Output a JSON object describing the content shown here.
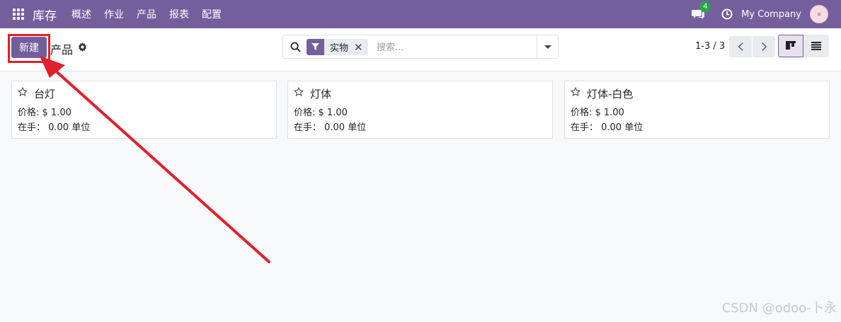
{
  "topbar": {
    "app_name": "库存",
    "menu": [
      "概述",
      "作业",
      "产品",
      "报表",
      "配置"
    ],
    "chat_badge": "4",
    "company": "My Company"
  },
  "control": {
    "new_label": "新建",
    "breadcrumb": "产品",
    "facet_label": "实物",
    "search_placeholder": "搜索...",
    "pager": "1-3 / 3"
  },
  "products": [
    {
      "name": "台灯",
      "price": "价格: $ 1.00",
      "onhand": "在手： 0.00 单位"
    },
    {
      "name": "灯体",
      "price": "价格: $ 1.00",
      "onhand": "在手： 0.00 单位"
    },
    {
      "name": "灯体-白色",
      "price": "价格: $ 1.00",
      "onhand": "在手： 0.00 单位"
    }
  ],
  "watermark": "CSDN @odoo-卜永",
  "colors": {
    "brand": "#745e9c",
    "annotation": "#e0202a",
    "badge": "#28a745"
  }
}
